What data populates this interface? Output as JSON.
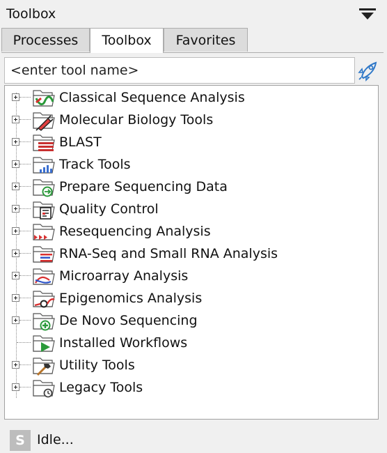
{
  "header": {
    "title": "Toolbox",
    "menu_icon": "dropdown-menu-icon"
  },
  "tabs": [
    {
      "label": "Processes",
      "active": false
    },
    {
      "label": "Toolbox",
      "active": true
    },
    {
      "label": "Favorites",
      "active": false
    }
  ],
  "search": {
    "placeholder": "<enter tool name>",
    "value": "",
    "button_icon": "rocket-icon"
  },
  "tree": {
    "items": [
      {
        "label": "Classical Sequence Analysis",
        "icon": "classical-sequence-analysis-icon",
        "expandable": true
      },
      {
        "label": "Molecular Biology Tools",
        "icon": "molecular-biology-tools-icon",
        "expandable": true
      },
      {
        "label": "BLAST",
        "icon": "blast-icon",
        "expandable": true
      },
      {
        "label": "Track Tools",
        "icon": "track-tools-icon",
        "expandable": true
      },
      {
        "label": "Prepare Sequencing Data",
        "icon": "prepare-sequencing-data-icon",
        "expandable": true
      },
      {
        "label": "Quality Control",
        "icon": "quality-control-icon",
        "expandable": true
      },
      {
        "label": "Resequencing Analysis",
        "icon": "resequencing-analysis-icon",
        "expandable": true
      },
      {
        "label": "RNA-Seq and Small RNA Analysis",
        "icon": "rna-seq-icon",
        "expandable": true
      },
      {
        "label": "Microarray Analysis",
        "icon": "microarray-analysis-icon",
        "expandable": true
      },
      {
        "label": "Epigenomics Analysis",
        "icon": "epigenomics-analysis-icon",
        "expandable": true
      },
      {
        "label": "De Novo Sequencing",
        "icon": "de-novo-sequencing-icon",
        "expandable": true
      },
      {
        "label": "Installed Workflows",
        "icon": "installed-workflows-icon",
        "expandable": false
      },
      {
        "label": "Utility Tools",
        "icon": "utility-tools-icon",
        "expandable": true
      },
      {
        "label": "Legacy Tools",
        "icon": "legacy-tools-icon",
        "expandable": true
      }
    ]
  },
  "status": {
    "icon_letter": "S",
    "text": "Idle..."
  }
}
